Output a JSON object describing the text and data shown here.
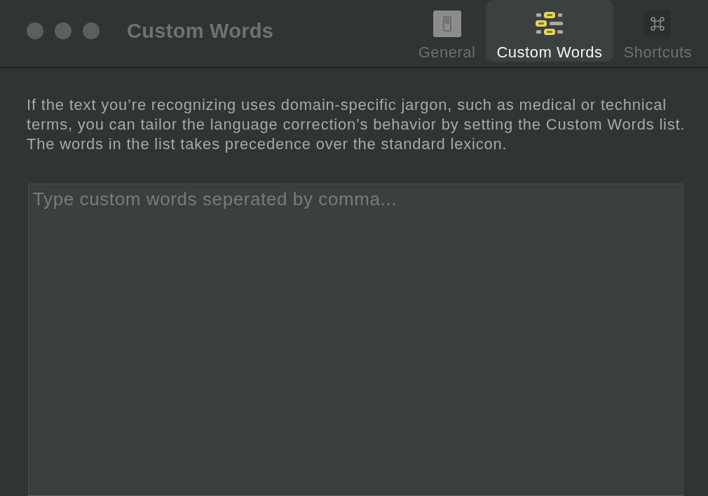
{
  "window": {
    "title": "Custom Words"
  },
  "tabs": [
    {
      "label": "General",
      "selected": false,
      "kind": "switch"
    },
    {
      "label": "Custom Words",
      "selected": true,
      "kind": "list"
    },
    {
      "label": "Shortcuts",
      "selected": false,
      "kind": "command"
    }
  ],
  "description": "If the text you’re recognizing uses domain-specific jargon, such as medical or technical terms, you can tailor the language correction’s behavior by setting the Custom Words list. The words in the list takes precedence over the standard lexicon.",
  "custom_words": {
    "placeholder": "Type custom words seperated by comma..."
  }
}
